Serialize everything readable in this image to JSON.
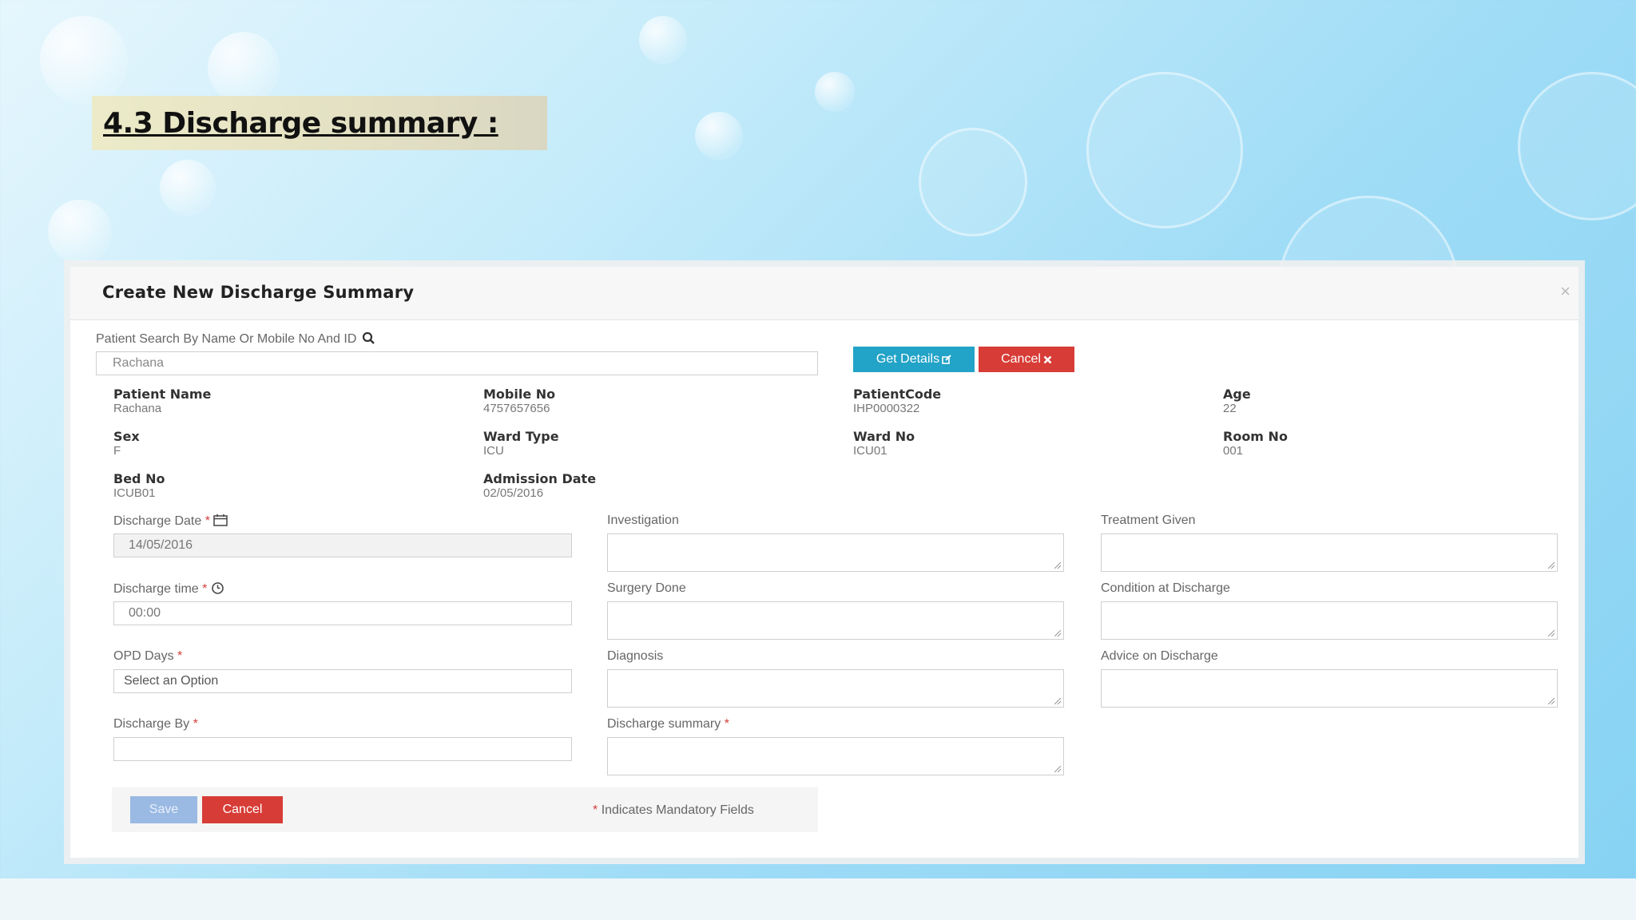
{
  "slide": {
    "title": "4.3 Discharge summary :"
  },
  "modal": {
    "title": "Create New Discharge Summary",
    "close": "×"
  },
  "search": {
    "label": "Patient Search By Name Or Mobile No And ID",
    "value": "Rachana",
    "get_details": "Get Details",
    "cancel": "Cancel"
  },
  "patient": [
    {
      "label": "Patient Name",
      "value": "Rachana"
    },
    {
      "label": "Mobile No",
      "value": "4757657656"
    },
    {
      "label": "PatientCode",
      "value": "IHP0000322"
    },
    {
      "label": "Age",
      "value": "22"
    },
    {
      "label": "Sex",
      "value": "F"
    },
    {
      "label": "Ward Type",
      "value": "ICU"
    },
    {
      "label": "Ward No",
      "value": "ICU01"
    },
    {
      "label": "Room No",
      "value": "001"
    },
    {
      "label": "Bed No",
      "value": "ICUB01"
    },
    {
      "label": "Admission Date",
      "value": "02/05/2016"
    }
  ],
  "form": {
    "discharge_date": {
      "label": "Discharge Date",
      "value": "14/05/2016"
    },
    "discharge_time": {
      "label": "Discharge time",
      "value": "00:00"
    },
    "opd_days": {
      "label": "OPD Days",
      "value": "Select an Option"
    },
    "discharge_by": {
      "label": "Discharge By",
      "value": ""
    },
    "investigation": {
      "label": "Investigation"
    },
    "surgery_done": {
      "label": "Surgery Done"
    },
    "diagnosis": {
      "label": "Diagnosis"
    },
    "discharge_summary": {
      "label": "Discharge summary"
    },
    "treatment_given": {
      "label": "Treatment Given"
    },
    "condition_at_discharge": {
      "label": "Condition at Discharge"
    },
    "advice_on_discharge": {
      "label": "Advice on Discharge"
    },
    "required_mark": "*"
  },
  "footer": {
    "save": "Save",
    "cancel": "Cancel",
    "mandatory_note": "Indicates Mandatory Fields"
  }
}
